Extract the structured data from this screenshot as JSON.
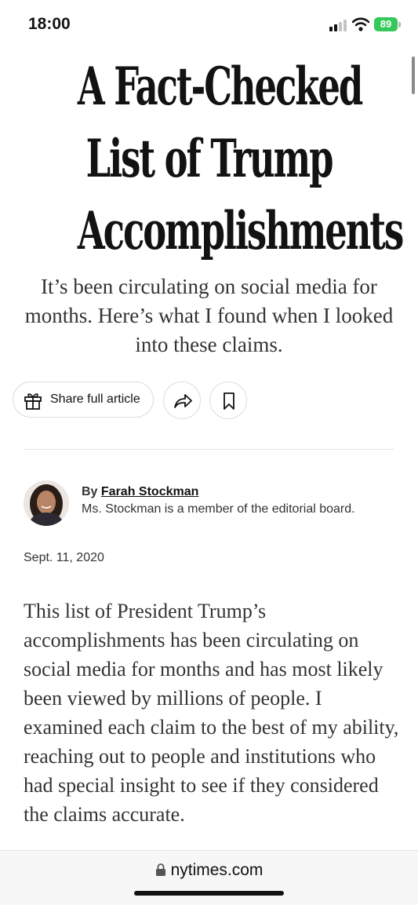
{
  "status_bar": {
    "time": "18:00",
    "battery": "89"
  },
  "article": {
    "headline_lines": [
      "A Fact-Checked",
      "List of Trump",
      "Accomplishments"
    ],
    "summary": "It’s been circulating on social media for months. Here’s what I found when I looked into these claims.",
    "actions": {
      "share_label": "Share full article",
      "forward_icon": "forward-arrow-icon",
      "bookmark_icon": "bookmark-icon"
    },
    "byline": {
      "prefix": "By ",
      "author": "Farah Stockman",
      "description": "Ms. Stockman is a member of the editorial board."
    },
    "date": "Sept. 11, 2020",
    "body": "This list of President Trump’s accomplishments has been circulating on social media for months and has most likely been viewed by millions of people. I examined each claim to the best of my ability, reaching out to people and institutions who had special insight to see if they considered the claims accurate."
  },
  "browser": {
    "url": "nytimes.com"
  },
  "colors": {
    "battery": "#34c759",
    "text": "#121212"
  }
}
